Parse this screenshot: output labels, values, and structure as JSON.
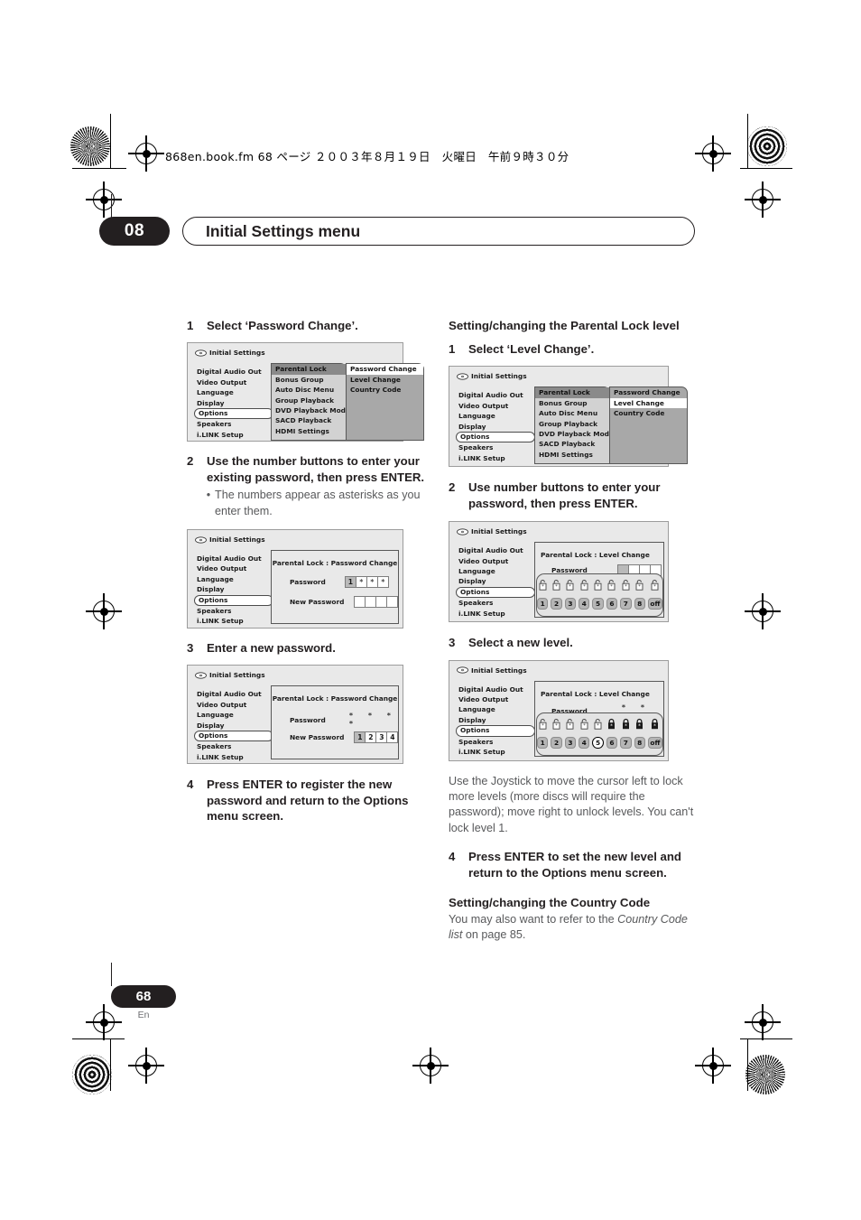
{
  "header": {
    "file_line": "868en.book.fm  68 ページ  ２００３年８月１９日　火曜日　午前９時３０分"
  },
  "chapter": {
    "number": "08",
    "title": "Initial Settings menu"
  },
  "footer": {
    "page_number": "68",
    "language": "En"
  },
  "osd_common": {
    "title": "Initial Settings",
    "categories": [
      "Digital Audio Out",
      "Video Output",
      "Language",
      "Display",
      "Options",
      "Speakers",
      "i.LINK Setup"
    ],
    "selected_category": "Options",
    "parental_items": [
      "Parental Lock",
      "Bonus Group",
      "Auto Disc Menu",
      "Group Playback",
      "DVD Playback Mode",
      "SACD Playback",
      "HDMI Settings"
    ],
    "parental_selected": "Parental Lock",
    "sub_items": [
      "Password Change",
      "Level Change",
      "Country Code"
    ],
    "scroll_arrow": "▼"
  },
  "left_column": {
    "step1": {
      "n": "1",
      "text": "Select ‘Password Change’."
    },
    "osd1": {
      "sub_selected": "Password Change"
    },
    "step2": {
      "n": "2",
      "text": "Use the number buttons to enter your existing password, then press ENTER.",
      "bullet": "The numbers appear as asterisks as you enter them."
    },
    "osd2": {
      "heading": "Parental Lock : Password Change",
      "password_label": "Password",
      "password_values": [
        "1",
        "*",
        "*",
        "*"
      ],
      "new_password_label": "New Password",
      "new_password_values": [
        "",
        "",
        "",
        ""
      ]
    },
    "step3": {
      "n": "3",
      "text": "Enter a new password."
    },
    "osd3": {
      "heading": "Parental Lock : Password Change",
      "password_label": "Password",
      "password_stars": "* * * *",
      "new_password_label": "New Password",
      "new_password_values": [
        "1",
        "2",
        "3",
        "4"
      ]
    },
    "step4": {
      "n": "4",
      "text": "Press ENTER to register the new password and return to the Options menu screen."
    }
  },
  "right_column": {
    "heading1": "Setting/changing the Parental Lock level",
    "step1": {
      "n": "1",
      "text": "Select ‘Level Change’."
    },
    "osd1": {
      "sub_selected": "Level Change"
    },
    "step2": {
      "n": "2",
      "text": "Use number buttons to enter your password, then press ENTER."
    },
    "osd2": {
      "heading": "Parental Lock : Level Change",
      "password_label": "Password",
      "password_values": [
        "_",
        "_",
        "_",
        "_"
      ],
      "levels": [
        "1",
        "2",
        "3",
        "4",
        "5",
        "6",
        "7",
        "8",
        "off"
      ],
      "lock_states": [
        "open",
        "open",
        "open",
        "open",
        "open",
        "open",
        "open",
        "open",
        "open"
      ],
      "selected_level": ""
    },
    "step3": {
      "n": "3",
      "text": "Select a new level."
    },
    "osd3": {
      "heading": "Parental Lock : Level Change",
      "password_label": "Password",
      "password_stars": "* * * *",
      "levels": [
        "1",
        "2",
        "3",
        "4",
        "5",
        "6",
        "7",
        "8",
        "off"
      ],
      "lock_states": [
        "open",
        "open",
        "open",
        "open",
        "open",
        "closed",
        "closed",
        "closed",
        "closed"
      ],
      "selected_level": "5"
    },
    "note": "Use the Joystick to move the cursor left to lock more levels (more discs will require the password); move right to unlock levels. You can't lock level 1.",
    "step4": {
      "n": "4",
      "text": "Press ENTER to set the new level and return to the Options menu screen."
    },
    "heading2": "Setting/changing the Country Code",
    "note2_a": "You may also want to refer to the ",
    "note2_italic": "Country Code list",
    "note2_b": " on page 85."
  }
}
